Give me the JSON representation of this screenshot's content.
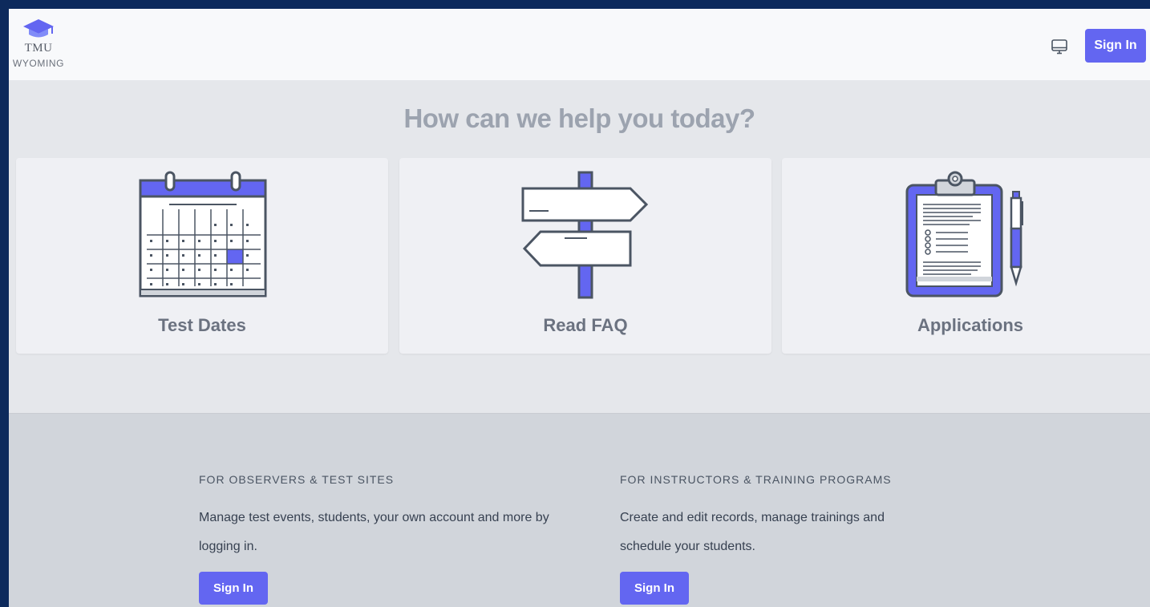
{
  "header": {
    "logo_line1": "TMU",
    "logo_line2": "WYOMING",
    "monitor_icon": "monitor-icon",
    "signin_label": "Sign In"
  },
  "help": {
    "title": "How can we help you today?",
    "cards": [
      {
        "label": "Test Dates",
        "icon": "calendar-icon"
      },
      {
        "label": "Read FAQ",
        "icon": "signpost-icon"
      },
      {
        "label": "Applications",
        "icon": "clipboard-icon"
      }
    ]
  },
  "footer": {
    "observers": {
      "heading": "FOR OBSERVERS & TEST SITES",
      "text": "Manage test events, students, your own account and more by logging in.",
      "button": "Sign In"
    },
    "instructors": {
      "heading": "FOR INSTRUCTORS & TRAINING PROGRAMS",
      "text": "Create and edit records, manage trainings and schedule your students.",
      "button": "Sign In"
    }
  },
  "colors": {
    "accent": "#6366f1",
    "frame": "#0d2a5c",
    "page_bg": "#e5e7eb",
    "footer_bg": "#d1d5db"
  }
}
